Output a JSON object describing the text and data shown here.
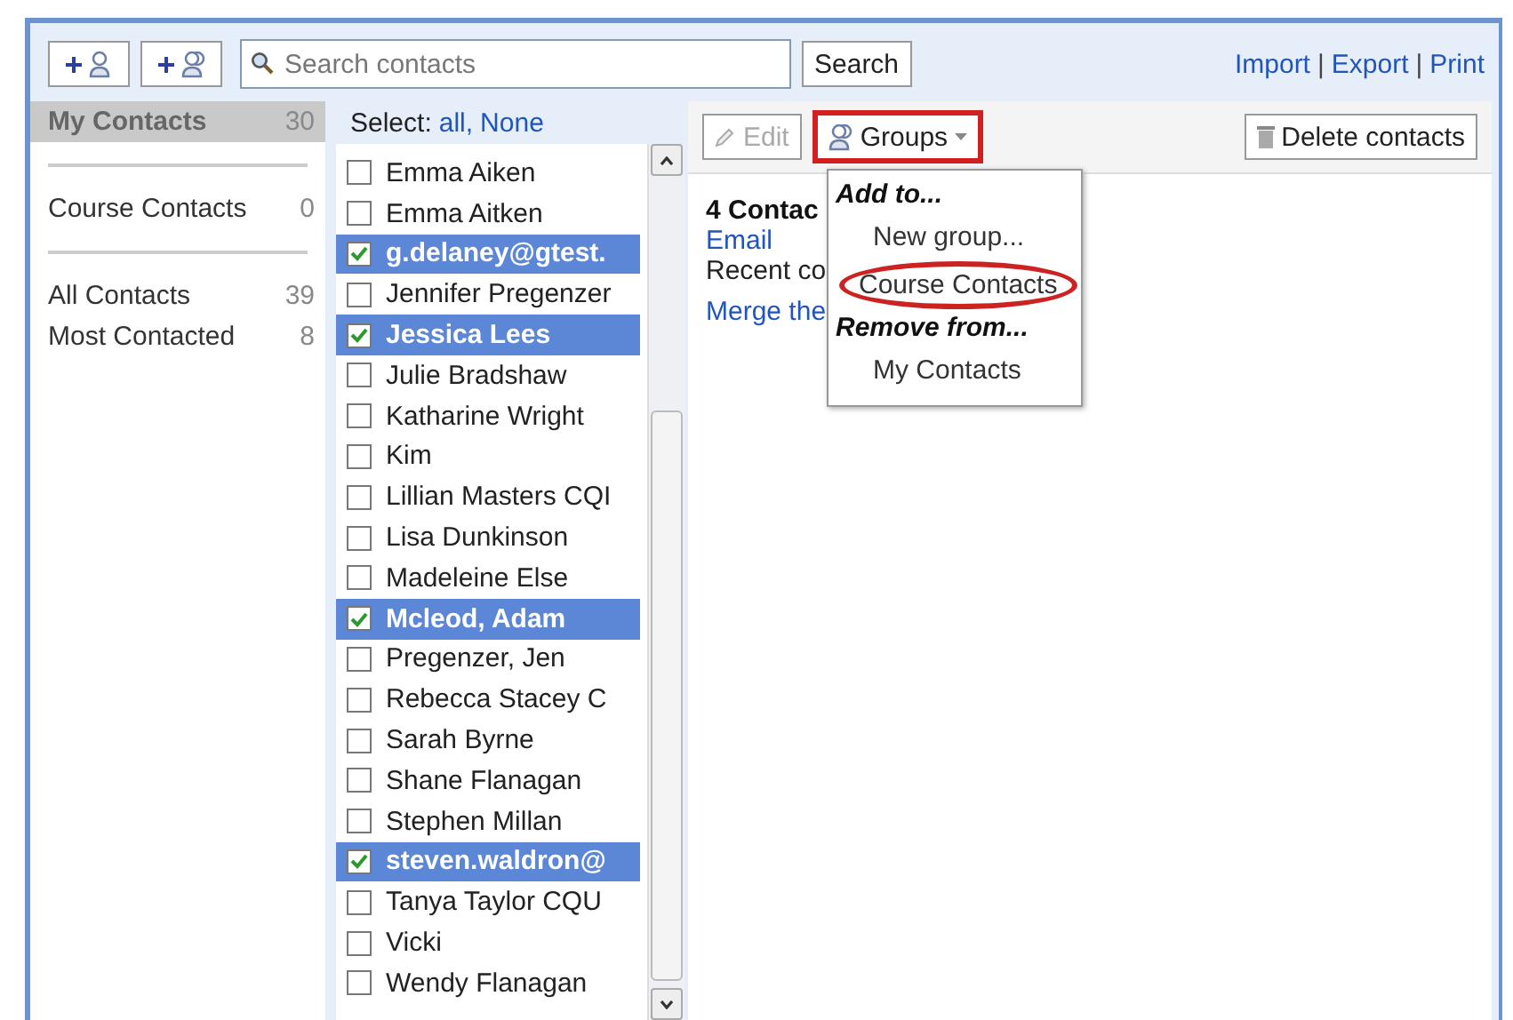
{
  "toolbar": {
    "add_buttons": [
      {
        "kind": "contact"
      },
      {
        "kind": "group"
      }
    ],
    "search": {
      "placeholder": "Search contacts"
    },
    "search_button": "Search",
    "links": [
      "Import",
      "Export",
      "Print"
    ],
    "link_separator": "|"
  },
  "sidebar": {
    "groups": [
      {
        "label": "My Contacts",
        "count": "30",
        "selected": true
      },
      {
        "label": "Course Contacts",
        "count": "0",
        "selected": false
      },
      {
        "label": "All Contacts",
        "count": "39",
        "selected": false
      },
      {
        "label": "Most Contacted",
        "count": "8",
        "selected": false
      }
    ]
  },
  "contact_list": {
    "select_label": "Select:",
    "select_links": [
      "all,",
      "None"
    ],
    "contacts": [
      {
        "name": "Emma Aiken",
        "checked": false
      },
      {
        "name": "Emma Aitken",
        "checked": false
      },
      {
        "name": "g.delaney@gtest.",
        "checked": true
      },
      {
        "name": "Jennifer Pregenzer",
        "checked": false
      },
      {
        "name": "Jessica Lees",
        "checked": true
      },
      {
        "name": "Julie Bradshaw",
        "checked": false
      },
      {
        "name": "Katharine Wright",
        "checked": false
      },
      {
        "name": "Kim",
        "checked": false
      },
      {
        "name": "Lillian Masters CQI",
        "checked": false
      },
      {
        "name": "Lisa Dunkinson",
        "checked": false
      },
      {
        "name": "Madeleine Else",
        "checked": false
      },
      {
        "name": "Mcleod, Adam",
        "checked": true
      },
      {
        "name": "Pregenzer, Jen",
        "checked": false
      },
      {
        "name": "Rebecca Stacey C",
        "checked": false
      },
      {
        "name": "Sarah Byrne",
        "checked": false
      },
      {
        "name": "Shane Flanagan",
        "checked": false
      },
      {
        "name": "Stephen Millan",
        "checked": false
      },
      {
        "name": "steven.waldron@",
        "checked": true
      },
      {
        "name": "Tanya Taylor CQU",
        "checked": false
      },
      {
        "name": "Vicki",
        "checked": false
      },
      {
        "name": "Wendy Flanagan",
        "checked": false
      }
    ]
  },
  "actions": {
    "edit": {
      "label": "Edit",
      "disabled": true
    },
    "groups": {
      "label": "Groups",
      "annotated": true
    },
    "delete": "Delete contacts"
  },
  "details": {
    "heading": "4 Contac",
    "email_link": "Email",
    "recent": "Recent co",
    "merge_link": "Merge the"
  },
  "groups_menu": {
    "sections": [
      {
        "heading": "Add to...",
        "items": [
          {
            "label": "New group...",
            "annotated": false
          },
          {
            "label": "Course Contacts",
            "annotated": true
          }
        ]
      },
      {
        "heading": "Remove from...",
        "items": [
          {
            "label": "My Contacts",
            "annotated": false
          }
        ]
      }
    ]
  }
}
